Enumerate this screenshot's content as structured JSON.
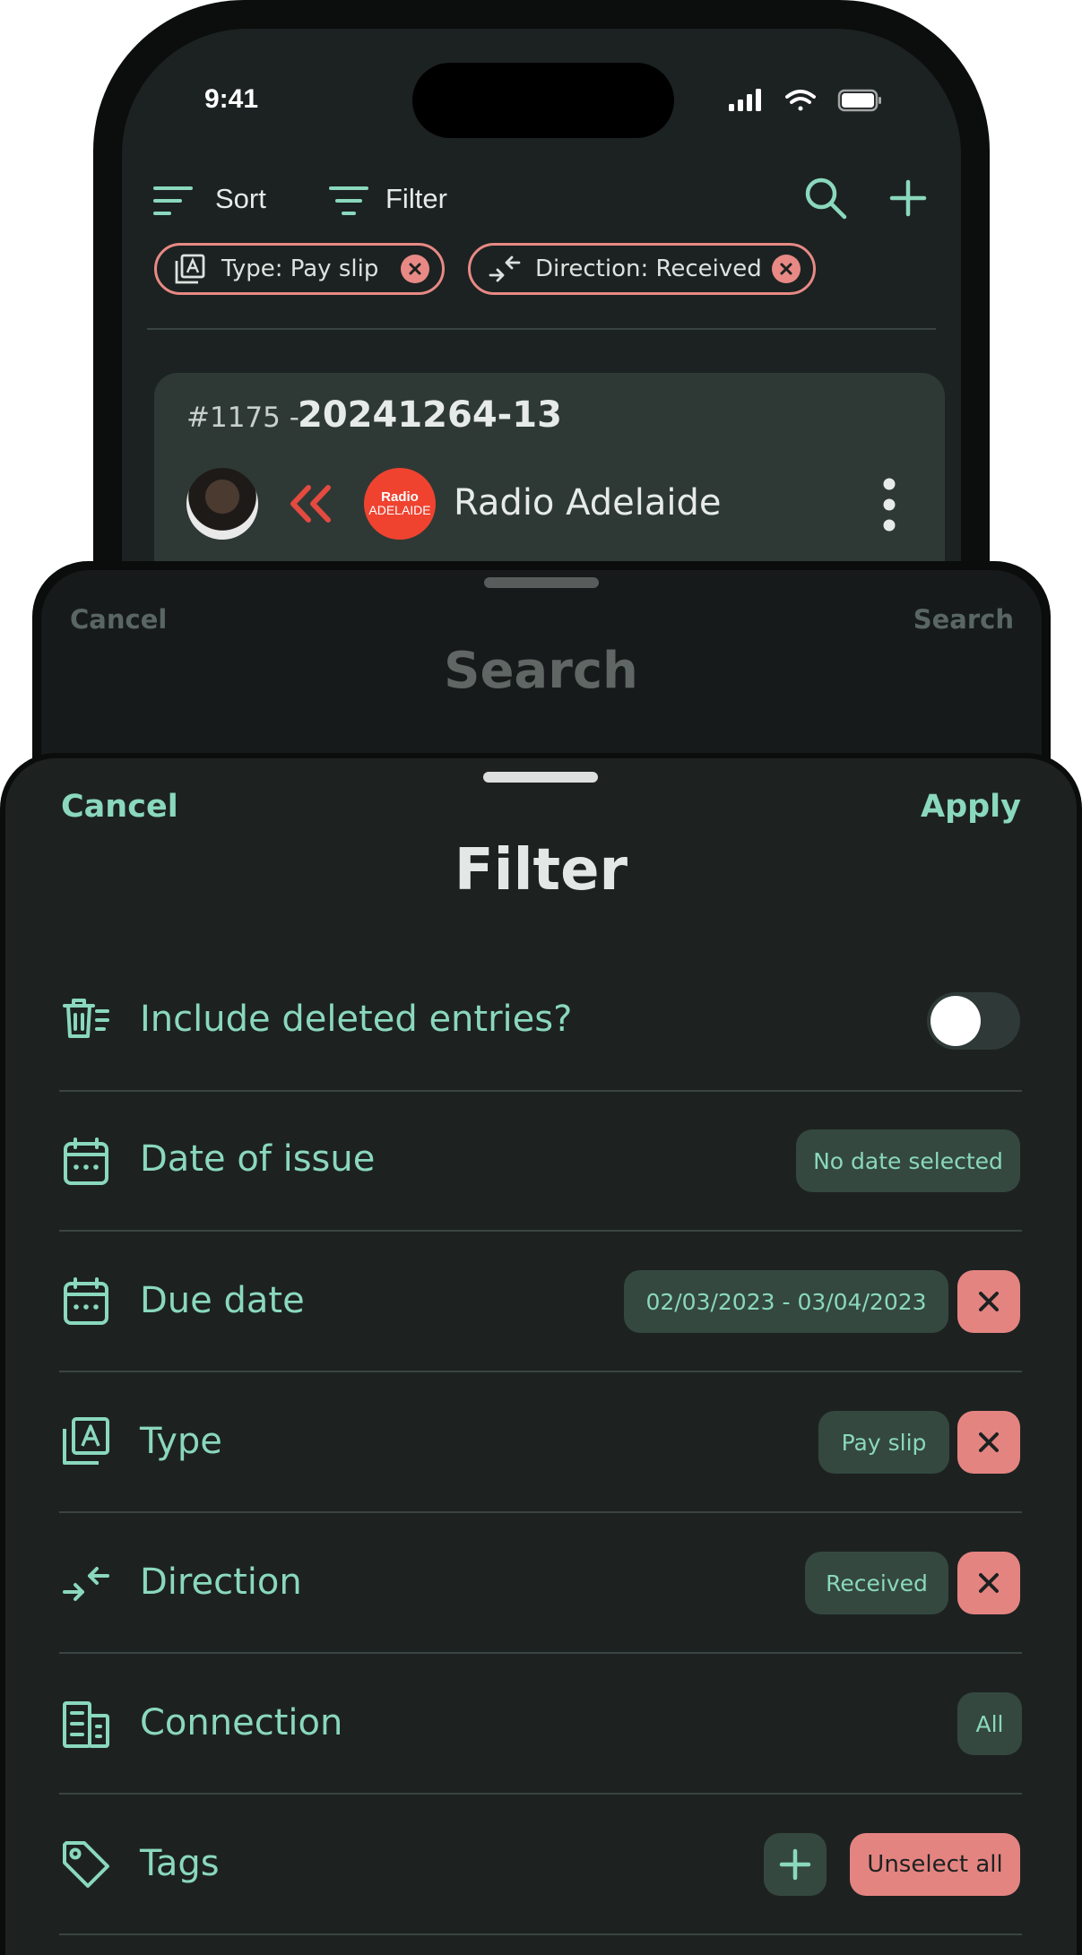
{
  "status": {
    "time": "9:41"
  },
  "toolbar": {
    "sort_label": "Sort",
    "filter_label": "Filter",
    "chips": [
      {
        "label": "Type: Pay slip"
      },
      {
        "label": "Direction: Received"
      }
    ]
  },
  "card": {
    "number": "#1175 -",
    "title": "20241264-13",
    "company": "Radio Adelaide",
    "logo_top": "Radio",
    "logo_bottom": "ADELAIDE"
  },
  "search_sheet": {
    "cancel_label": "Cancel",
    "search_label": "Search",
    "title": "Search"
  },
  "filter_sheet": {
    "cancel_label": "Cancel",
    "apply_label": "Apply",
    "title": "Filter",
    "rows": {
      "deleted": {
        "label": "Include deleted entries?",
        "toggle": false,
        "icon": "trash-list-icon"
      },
      "date_of_issue": {
        "label": "Date of issue",
        "value": "No date selected",
        "icon": "calendar-icon"
      },
      "due_date": {
        "label": "Due date",
        "value": "02/03/2023 - 03/04/2023",
        "icon": "calendar-icon"
      },
      "type": {
        "label": "Type",
        "value": "Pay slip",
        "icon": "document-type-icon"
      },
      "direction": {
        "label": "Direction",
        "value": "Received",
        "icon": "direction-icon"
      },
      "connection": {
        "label": "Connection",
        "value": "All",
        "icon": "building-icon"
      },
      "tags": {
        "label": "Tags",
        "unselect_label": "Unselect all",
        "icon": "tag-icon"
      }
    }
  },
  "colors": {
    "accent": "#8ad8bd",
    "danger": "#e48481",
    "sheet_bg": "#1d2221",
    "pill_bg": "#34483f",
    "brand_red": "#ef4330"
  }
}
